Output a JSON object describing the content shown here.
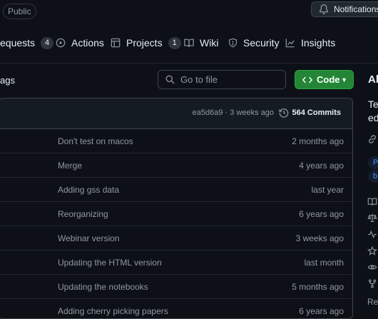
{
  "header": {
    "visibility_badge": "Public",
    "notifications_label": "Notifications"
  },
  "nav": {
    "pull_requests": "equests",
    "pull_requests_count": "4",
    "actions": "Actions",
    "projects": "Projects",
    "projects_count": "1",
    "wiki": "Wiki",
    "security": "Security",
    "insights": "Insights"
  },
  "toolbar": {
    "tags_label": "ags",
    "go_to_file_placeholder": "Go to file",
    "code_button": "Code"
  },
  "latest_commit": {
    "info": "ea5d6a9 · 3 weeks ago",
    "count": "564 Commits"
  },
  "files": [
    {
      "message": "Don't test on macos",
      "when": "2 months ago"
    },
    {
      "message": "Merge",
      "when": "4 years ago"
    },
    {
      "message": "Adding gss data",
      "when": "last year"
    },
    {
      "message": "Reorganizing",
      "when": "6 years ago"
    },
    {
      "message": "Webinar version",
      "when": "3 weeks ago"
    },
    {
      "message": "Updating the HTML version",
      "when": "last month"
    },
    {
      "message": "Updating the notebooks",
      "when": "5 months ago"
    },
    {
      "message": "Adding cherry picking papers",
      "when": "6 years ago"
    }
  ],
  "sidebar": {
    "about_heading": "Ab",
    "desc_line1": "Tex",
    "desc_line2": "ed",
    "topic1": "P",
    "topic2": "b",
    "footer": "Rep"
  },
  "colors": {
    "background": "#0d1117",
    "code_button": "#238636",
    "link": "#4493f8"
  }
}
